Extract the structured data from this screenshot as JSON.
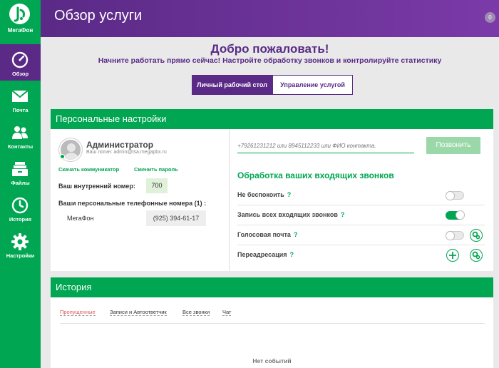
{
  "brand": {
    "name": "МегаФон",
    "accent": "#00a651",
    "purple": "#5a2a86"
  },
  "header": {
    "title": "Обзор услуги",
    "notifications": "0"
  },
  "sidebar": {
    "items": [
      {
        "label": "Обзор",
        "icon": "speedometer-icon",
        "active": true
      },
      {
        "label": "Почта",
        "icon": "mail-icon"
      },
      {
        "label": "Контакты",
        "icon": "contacts-icon"
      },
      {
        "label": "Файлы",
        "icon": "files-icon"
      },
      {
        "label": "История",
        "icon": "history-icon"
      },
      {
        "label": "Настройки",
        "icon": "gear-icon"
      }
    ]
  },
  "welcome": {
    "title": "Добро пожаловать!",
    "subtitle": "Начните работать прямо сейчас! Настройте обработку звонков и контролируйте статистику"
  },
  "tabs": [
    "Личный рабочий стол",
    "Управление услугой"
  ],
  "personal": {
    "heading": "Персональные настройки",
    "name": "Администратор",
    "login": "Ваш логин: admin@tsa.megapbx.ru",
    "download_link": "Скачать коммуникатор",
    "change_password_link": "Сменить пароль",
    "ext_label": "Ваш внутренний номер:",
    "ext_value": "700",
    "phones_label": "Ваши персональные телефонные номера (1) :",
    "operator": "МегаФон",
    "phone": "(925) 394-61-17"
  },
  "dialer": {
    "placeholder": "+79261231212 или 8945112233 или ФИО контакта.",
    "call_label": "Позвонить"
  },
  "incoming": {
    "title": "Обработка ваших входящих звонков",
    "help": "?",
    "settings": [
      {
        "label": "Не беспокоить",
        "state": "off"
      },
      {
        "label": "Запись всех входящих звонков",
        "state": "on"
      },
      {
        "label": "Голосовая почта",
        "state": "off"
      },
      {
        "label": "Переадресация",
        "state": "add"
      }
    ]
  },
  "history": {
    "heading": "История",
    "tabs": [
      "Пропущенные",
      "Записи и Автоответчик",
      "Все звонки",
      "Чат"
    ],
    "empty": "Нет событий"
  }
}
